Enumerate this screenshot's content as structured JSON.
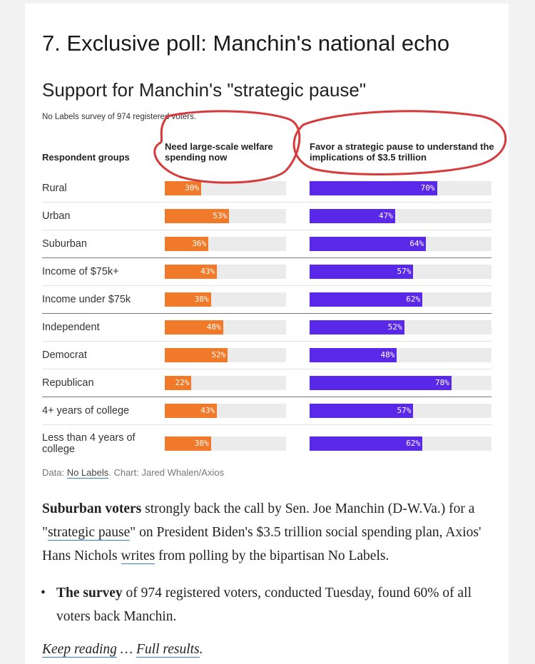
{
  "heading": "7. Exclusive poll: Manchin's national echo",
  "chart_data": {
    "type": "bar",
    "title": "Support for Manchin's \"strategic pause\"",
    "subtitle": "No Labels survey of 974 registered voters.",
    "row_header": "Respondent groups",
    "categories": [
      "Rural",
      "Urban",
      "Suburban",
      "Income of $75k+",
      "Income under $75k",
      "Independent",
      "Democrat",
      "Republican",
      "4+ years of college",
      "Less than 4 years of college"
    ],
    "series": [
      {
        "name": "Need large-scale welfare spending now",
        "values": [
          30,
          53,
          36,
          43,
          38,
          48,
          52,
          22,
          43,
          38
        ],
        "color": "#f07a2a"
      },
      {
        "name": "Favor a strategic pause to understand the implications of $3.5 trillion",
        "values": [
          70,
          47,
          64,
          57,
          62,
          52,
          48,
          78,
          57,
          62
        ],
        "color": "#5a28e8"
      }
    ],
    "ylim": [
      0,
      100
    ],
    "source_prefix": "Data: ",
    "source_link": "No Labels",
    "source_suffix": ". Chart: Jared Whalen/Axios",
    "annotation_color": "#d63a3a"
  },
  "article": {
    "p1_bold": "Suburban voters",
    "p1_a": " strongly back the call by Sen. Joe Manchin (D-W.Va.) for a \"",
    "p1_link1": "strategic pause",
    "p1_b": "\" on President Biden's $3.5 trillion social spending plan, Axios' Hans Nichols ",
    "p1_link2": "writes",
    "p1_c": " from polling by the bipartisan No Labels.",
    "bullet_marker": "•",
    "bullet_bold": "The survey",
    "bullet_text": " of 974 registered voters, conducted Tuesday, found 60% of all voters back Manchin.",
    "keep_link": "Keep reading",
    "keep_sep": " … ",
    "results_link": "Full results",
    "keep_end": "."
  }
}
